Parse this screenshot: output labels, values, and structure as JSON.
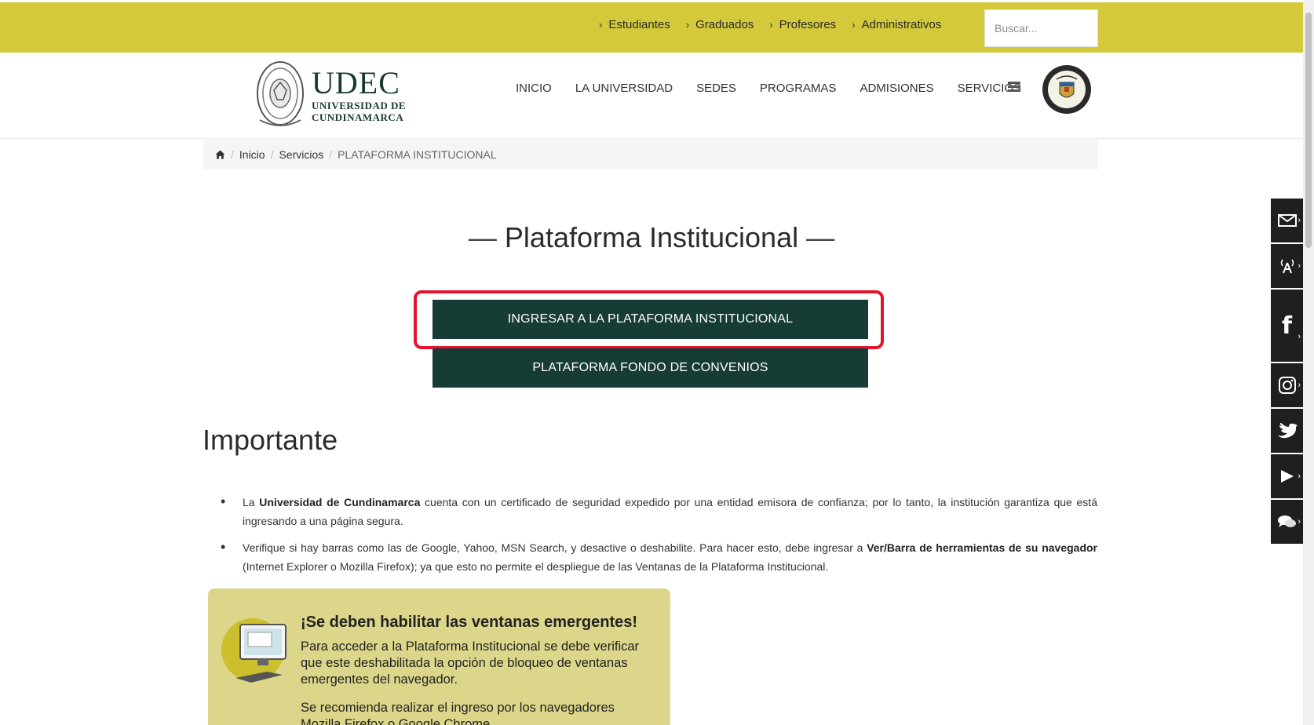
{
  "topbar": {
    "links": [
      "Estudiantes",
      "Graduados",
      "Profesores",
      "Administrativos"
    ],
    "search_placeholder": "Buscar..."
  },
  "header": {
    "logo_main": "UDEC",
    "logo_line1": "UNIVERSIDAD DE",
    "logo_line2": "CUNDINAMARCA",
    "nav": [
      "INICIO",
      "LA UNIVERSIDAD",
      "SEDES",
      "PROGRAMAS",
      "ADMISIONES",
      "SERVICIOS"
    ]
  },
  "breadcrumb": {
    "home_icon": "home-icon",
    "items": [
      "Inicio",
      "Servicios",
      "PLATAFORMA INSTITUCIONAL"
    ]
  },
  "main": {
    "title": "Plataforma Institucional",
    "button_primary": "INGRESAR A LA PLATAFORMA INSTITUCIONAL",
    "button_secondary": "PLATAFORMA FONDO DE CONVENIOS",
    "section_heading": "Importante",
    "bullet1_pre": "La ",
    "bullet1_bold": "Universidad de Cundinamarca",
    "bullet1_post": " cuenta con un certificado de seguridad expedido por una entidad emisora de confianza; por lo tanto, la institución garantiza que está ingresando a una página segura.",
    "bullet2_pre": "Verifique si hay barras como las de Google, Yahoo, MSN Search, y desactive o deshabilite. Para hacer esto, debe ingresar a ",
    "bullet2_bold": "Ver/Barra de herramientas de su navegador",
    "bullet2_post": " (Internet Explorer o Mozilla Firefox); ya que esto no permite el despliegue de las Ventanas de la Plataforma Institucional."
  },
  "notice": {
    "title": "¡Se deben habilitar las ventanas emergentes!",
    "body": "Para acceder a la Plataforma Institucional se debe verificar que este deshabilitada la opción de bloqueo de ventanas emergentes del navegador.",
    "body2": "Se recomienda realizar el ingreso por los navegadores Mozilla Firefox o Google Chrome."
  },
  "sidebar": {
    "icons": [
      "mail-icon",
      "broadcast-icon",
      "facebook-icon",
      "instagram-icon",
      "twitter-icon",
      "youtube-icon",
      "chat-icon"
    ]
  },
  "colors": {
    "topbar": "#d3c93a",
    "button": "#173c36",
    "highlight": "#e3142c",
    "notice_bg": "#dcd68a",
    "sidebar": "#1f1f1f"
  }
}
